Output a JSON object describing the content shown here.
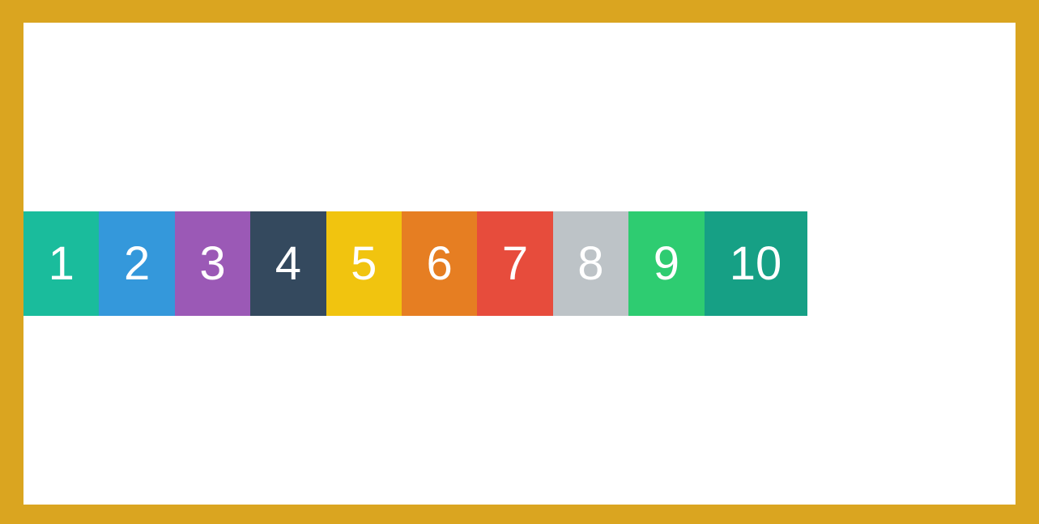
{
  "colors": {
    "border": "#DAA520",
    "canvas": "#FFFFFF",
    "text": "#FFFFFF"
  },
  "tiles": [
    {
      "label": "1",
      "color": "#1ABC9C"
    },
    {
      "label": "2",
      "color": "#3498DB"
    },
    {
      "label": "3",
      "color": "#9B59B6"
    },
    {
      "label": "4",
      "color": "#34495E"
    },
    {
      "label": "5",
      "color": "#F1C40F"
    },
    {
      "label": "6",
      "color": "#E67E22"
    },
    {
      "label": "7",
      "color": "#E74C3C"
    },
    {
      "label": "8",
      "color": "#BDC3C7"
    },
    {
      "label": "9",
      "color": "#2ECC71"
    },
    {
      "label": "10",
      "color": "#16A085"
    }
  ]
}
